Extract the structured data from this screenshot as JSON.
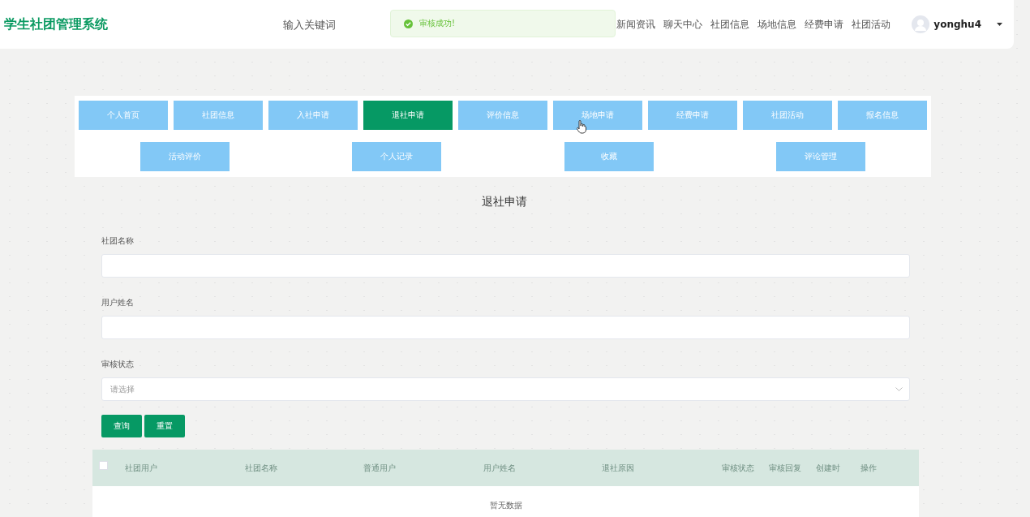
{
  "header": {
    "logo": "学生社团管理系统",
    "search": {
      "placeholder": "输入关键词"
    },
    "toast": {
      "kind": "success",
      "message": "审核成功!"
    },
    "nav": [
      "新闻资讯",
      "聊天中心",
      "社团信息",
      "场地信息",
      "经费申请",
      "社团活动"
    ],
    "user": {
      "name": "yonghu4"
    }
  },
  "tabs": [
    {
      "label": "个人首页",
      "selected": false
    },
    {
      "label": "社团信息",
      "selected": false
    },
    {
      "label": "入社申请",
      "selected": false
    },
    {
      "label": "退社申请",
      "selected": true
    },
    {
      "label": "评价信息",
      "selected": false
    },
    {
      "label": "场地申请",
      "selected": false
    },
    {
      "label": "经费申请",
      "selected": false
    },
    {
      "label": "社团活动",
      "selected": false
    },
    {
      "label": "报名信息",
      "selected": false
    }
  ],
  "sub_tabs": [
    {
      "label": "活动评价",
      "selected": false
    },
    {
      "label": "个人记录",
      "selected": false
    },
    {
      "label": "收藏",
      "selected": false
    },
    {
      "label": "评论管理",
      "selected": false
    }
  ],
  "page_title": "退社申请",
  "form": {
    "fields": [
      {
        "kind": "text",
        "label": "社团名称"
      },
      {
        "kind": "text",
        "label": "用户姓名"
      },
      {
        "kind": "select",
        "label": "审核状态",
        "placeholder": "请选择"
      }
    ],
    "buttons": [
      "查询",
      "重置"
    ]
  },
  "table": {
    "select_all_checked": false,
    "columns": [
      "社团用户",
      "社团名称",
      "普通用户",
      "用户姓名",
      "退社原因",
      "审核状态",
      "审核回复",
      "创建时",
      "操作"
    ],
    "empty_text": "暂无数据"
  }
}
